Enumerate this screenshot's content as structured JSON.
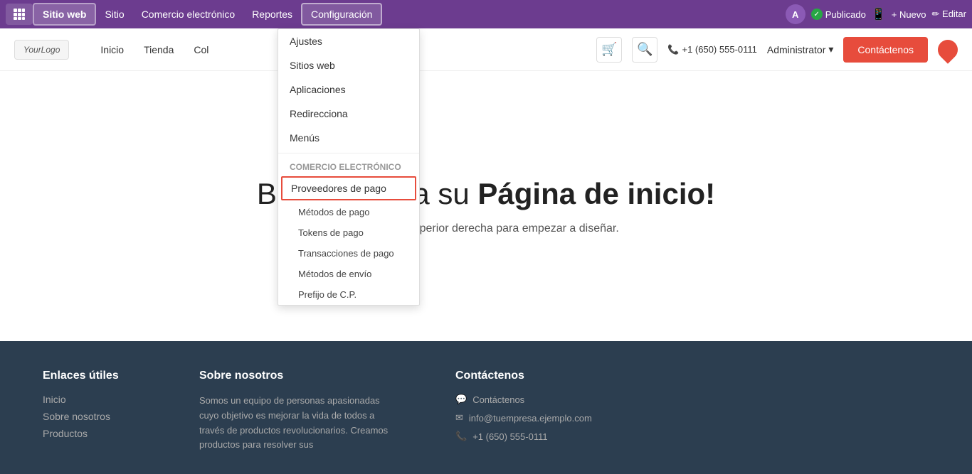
{
  "adminBar": {
    "gridIcon": "grid-icon",
    "sitioWeb": "Sitio web",
    "sitio": "Sitio",
    "comercioElectronico": "Comercio electrónico",
    "reportes": "Reportes",
    "configuracion": "Configuración",
    "avatar": "A",
    "publishedLabel": "Publicado",
    "nuevoLabel": "+ Nuevo",
    "editarLabel": "✏ Editar"
  },
  "siteNav": {
    "logoText": "YourLogo",
    "menuItems": [
      "Inicio",
      "Tienda",
      "Col"
    ],
    "phone": "+1 (650) 555-0111",
    "adminLabel": "Administrator",
    "contactBtn": "Contáctenos"
  },
  "dropdown": {
    "ajustes": "Ajustes",
    "sitiosWeb": "Sitios web",
    "aplicaciones": "Aplicaciones",
    "redireccionas": "Redirecciona",
    "menus": "Menús",
    "sectionLabel": "Comercio electrónico",
    "proveedoresDePago": "Proveedores de pago",
    "metodosDePago": "Métodos de pago",
    "tokensDePago": "Tokens de pago",
    "transaccionesDePago": "Transacciones de pago",
    "metodosDeEnvio": "Métodos de envío",
    "prefijoCp": "Prefijo de C.P."
  },
  "hero": {
    "titleStart": "Bienvenido a su ",
    "titleBold": "Página de inicio!",
    "subtitle": "…esquina superior derecha para empezar a diseñar."
  },
  "footer": {
    "col1": {
      "heading": "Enlaces útiles",
      "links": [
        "Inicio",
        "Sobre nosotros",
        "Productos"
      ]
    },
    "col2": {
      "heading": "Sobre nosotros",
      "text": "Somos un equipo de personas apasionadas cuyo objetivo es mejorar la vida de todos a través de productos revolucionarios. Creamos productos para resolver sus"
    },
    "col3": {
      "heading": "Contáctenos",
      "items": [
        {
          "icon": "💬",
          "label": "Contáctenos"
        },
        {
          "icon": "✉",
          "label": "info@tuempresa.ejemplo.com"
        },
        {
          "icon": "📞",
          "label": "+1 (650) 555-0111"
        }
      ]
    }
  }
}
